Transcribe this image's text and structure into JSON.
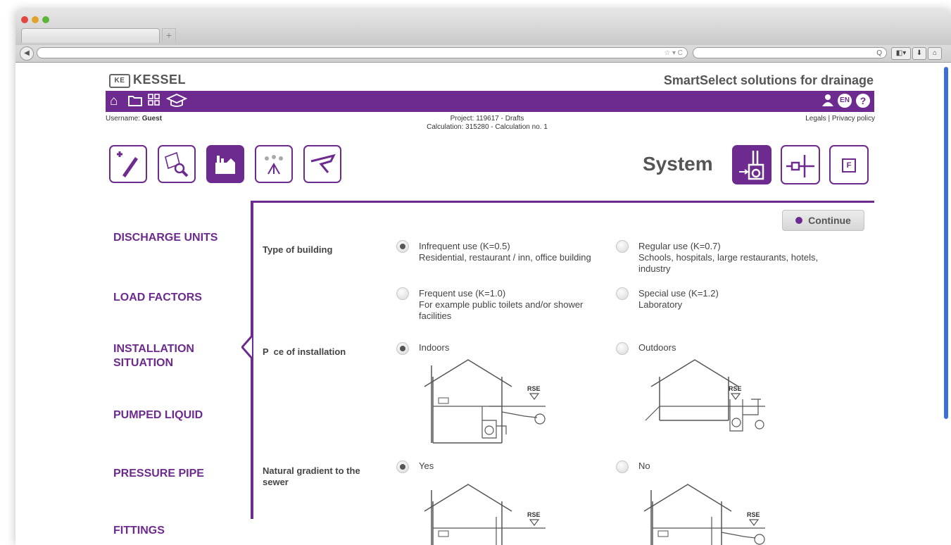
{
  "browser": {
    "tab_new_label": "+",
    "back_label": "◀",
    "url_suffix": "☆ ▾ C",
    "search_icon": "Q",
    "toolbar_buttons": [
      "◧▾",
      "⬇",
      "⌂"
    ]
  },
  "header": {
    "logo_mark": "KE",
    "logo_text": "KESSEL",
    "tagline": "SmartSelect solutions for drainage",
    "username_prefix": "Username:",
    "username": "Guest",
    "project_line": "Project: 119617 - Drafts",
    "calculation_line": "Calculation: 315280 - Calculation no. 1",
    "legals": "Legals",
    "privacy": "Privacy policy",
    "separator": "|",
    "lang": "EN",
    "help": "?"
  },
  "topbar_icons": [
    "home-icon",
    "folder-icon",
    "grid-icon",
    "graduation-cap-icon"
  ],
  "steps": [
    "new-calculation-icon",
    "search-documents-icon",
    "building-icon",
    "fittings-icon",
    "pipe-icon"
  ],
  "system": {
    "title": "System",
    "icons": [
      "pump-system-icon",
      "pipe-connection-icon",
      "filter-icon"
    ],
    "filter_letter": "F"
  },
  "nav": {
    "items": [
      "DISCHARGE UNITS",
      "LOAD FACTORS",
      "INSTALLATION SITUATION",
      "PUMPED LIQUID",
      "PRESSURE PIPE",
      "FITTINGS"
    ]
  },
  "form": {
    "continue_label": "Continue",
    "type_of_building": {
      "label": "Type of building",
      "options": [
        {
          "title": "Infrequent use (K=0.5)",
          "desc": "Residential, restaurant / inn, office building",
          "checked": true
        },
        {
          "title": "Regular use (K=0.7)",
          "desc": "Schools, hospitals, large restaurants, hotels, industry",
          "checked": false
        },
        {
          "title": "Frequent use (K=1.0)",
          "desc": "For example public toilets and/or shower facilities",
          "checked": false
        },
        {
          "title": "Special use (K=1.2)",
          "desc": "Laboratory",
          "checked": false
        }
      ]
    },
    "place_of_installation": {
      "label": "P  ce of installation",
      "options": [
        {
          "title": "Indoors",
          "checked": true,
          "diagram_label": "RSE"
        },
        {
          "title": "Outdoors",
          "checked": false,
          "diagram_label": "RSE"
        }
      ]
    },
    "natural_gradient": {
      "label": "Natural gradient to the sewer",
      "options": [
        {
          "title": "Yes",
          "checked": true,
          "diagram_label": "RSE"
        },
        {
          "title": "No",
          "checked": false,
          "diagram_label": "RSE"
        }
      ]
    }
  },
  "colors": {
    "brand_purple": "#6d2b8f",
    "text_gray": "#444444"
  }
}
